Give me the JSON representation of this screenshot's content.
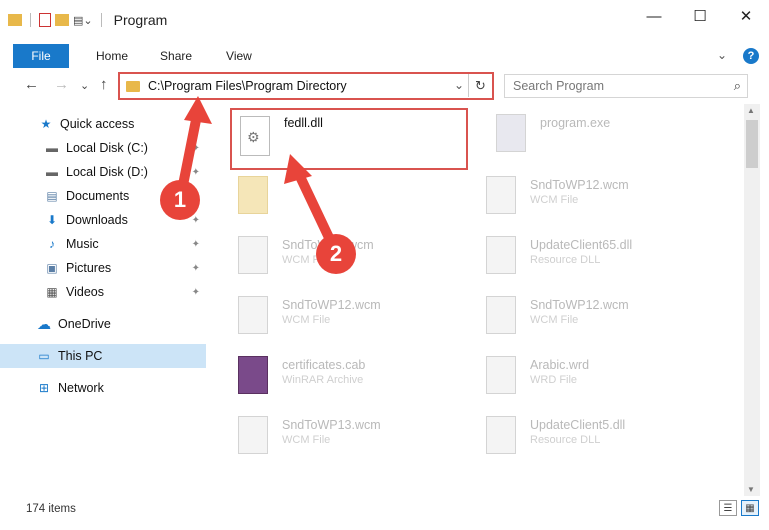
{
  "window": {
    "title": "Program",
    "controls": {
      "minimize": "—",
      "maximize": "☐",
      "close": "✕"
    }
  },
  "ribbon": {
    "file": "File",
    "tabs": [
      "Home",
      "Share",
      "View"
    ],
    "expand": "⌄",
    "help": "?"
  },
  "nav": {
    "back": "←",
    "forward": "→",
    "recent": "⌄",
    "up": "↑"
  },
  "address": {
    "path": "C:\\Program Files\\Program Directory",
    "dropdown": "⌄",
    "refresh": "↻"
  },
  "search": {
    "placeholder": "Search Program",
    "icon": "⌕"
  },
  "sidebar": {
    "items": [
      {
        "label": "Quick access",
        "icon": "star-icon",
        "glyph": "★",
        "pinned": false
      },
      {
        "label": "Local Disk (C:)",
        "icon": "drive-icon",
        "glyph": "▬",
        "pinned": true
      },
      {
        "label": "Local Disk (D:)",
        "icon": "drive-icon",
        "glyph": "▬",
        "pinned": true
      },
      {
        "label": "Documents",
        "icon": "documents-icon",
        "glyph": "▤",
        "pinned": true
      },
      {
        "label": "Downloads",
        "icon": "download-icon",
        "glyph": "⬇",
        "pinned": true
      },
      {
        "label": "Music",
        "icon": "music-icon",
        "glyph": "♪",
        "pinned": true
      },
      {
        "label": "Pictures",
        "icon": "pictures-icon",
        "glyph": "▣",
        "pinned": true
      },
      {
        "label": "Videos",
        "icon": "videos-icon",
        "glyph": "▦",
        "pinned": true
      },
      {
        "label": "OneDrive",
        "icon": "cloud-icon",
        "glyph": "☁",
        "pinned": false
      },
      {
        "label": "This PC",
        "icon": "computer-icon",
        "glyph": "▭",
        "pinned": false,
        "selected": true
      },
      {
        "label": "Network",
        "icon": "network-icon",
        "glyph": "⊞",
        "pinned": false
      }
    ],
    "pin_glyph": "📌"
  },
  "files": [
    {
      "name": "fedll.dll",
      "type": "",
      "highlight": true
    },
    {
      "name": "program.exe",
      "type": ""
    },
    {
      "name": "",
      "type": ""
    },
    {
      "name": "SndToWP12.wcm",
      "type": "WCM File"
    },
    {
      "name": "SndToWP6.wcm",
      "type": "WCM File"
    },
    {
      "name": "UpdateClient65.dll",
      "type": "Resource DLL"
    },
    {
      "name": "SndToWP12.wcm",
      "type": "WCM File"
    },
    {
      "name": "SndToWP12.wcm",
      "type": "WCM File"
    },
    {
      "name": "certificates.cab",
      "type": "WinRAR Archive"
    },
    {
      "name": "Arabic.wrd",
      "type": "WRD File"
    },
    {
      "name": "SndToWP13.wcm",
      "type": "WCM File"
    },
    {
      "name": "UpdateClient5.dll",
      "type": "Resource DLL"
    }
  ],
  "status": {
    "count": "174 items"
  },
  "callouts": {
    "one": "1",
    "two": "2"
  },
  "colors": {
    "accent": "#1979ca",
    "highlight": "#d9534f",
    "badge": "#e8443a",
    "selected": "#cce4f7"
  }
}
